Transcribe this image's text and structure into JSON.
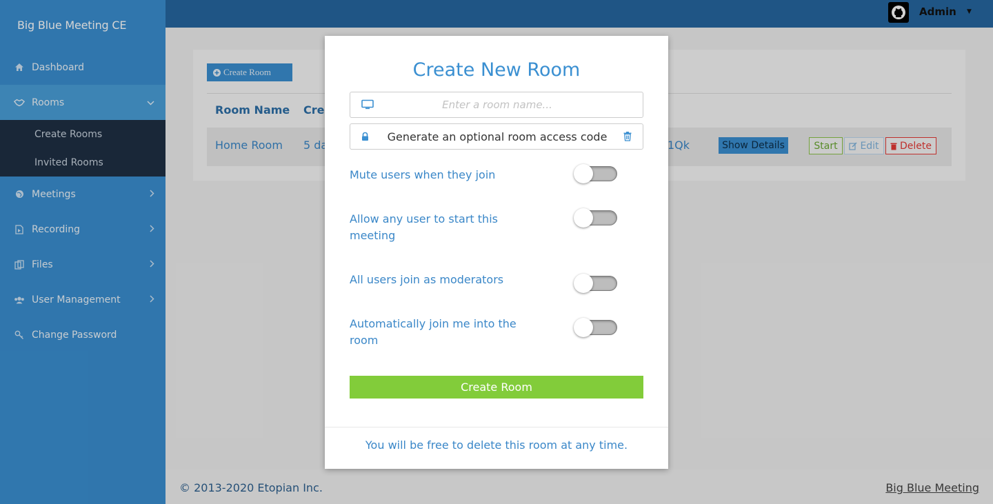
{
  "app": {
    "brand": "Big Blue Meeting CE"
  },
  "sidebar": {
    "items": [
      {
        "label": "Dashboard",
        "icon": "home-icon"
      },
      {
        "label": "Rooms",
        "icon": "handshake-icon",
        "active": true
      },
      {
        "label": "Meetings",
        "icon": "globe-icon"
      },
      {
        "label": "Recording",
        "icon": "video-file-icon"
      },
      {
        "label": "Files",
        "icon": "files-icon"
      },
      {
        "label": "User Management",
        "icon": "users-icon"
      },
      {
        "label": "Change Password",
        "icon": "key-icon"
      }
    ],
    "rooms_sub": [
      "Create Rooms",
      "Invited Rooms"
    ]
  },
  "topbar": {
    "user": "Admin"
  },
  "content": {
    "create_room_button": "Create Room",
    "table": {
      "headers": [
        "Room Name",
        "Crea"
      ],
      "row": {
        "name": "Home Room",
        "created": "5 da",
        "code_fragment": "1Qk"
      }
    },
    "actions": {
      "show_details": "Show Details",
      "start": "Start",
      "edit": "Edit",
      "delete": "Delete"
    }
  },
  "modal": {
    "title": "Create New Room",
    "room_name_placeholder": "Enter a room name...",
    "access_code_label": "Generate an optional room access code",
    "options": [
      {
        "label": "Mute users when they join",
        "on": false
      },
      {
        "label": "Allow any user to start this meeting",
        "on": false
      },
      {
        "label": "All users join as moderators",
        "on": false
      },
      {
        "label": "Automatically join me into the room",
        "on": false
      }
    ],
    "submit": "Create Room",
    "note": "You will be free to delete this room at any time."
  },
  "footer": {
    "copyright": "© 2013-2020 Etopian Inc.",
    "link": "Big Blue Meeting"
  },
  "colors": {
    "sidebar": "#3a8fd1",
    "topbar": "#2667a0",
    "accent": "#3a8fd1",
    "submit": "#82cc3a",
    "danger": "#e53935"
  }
}
